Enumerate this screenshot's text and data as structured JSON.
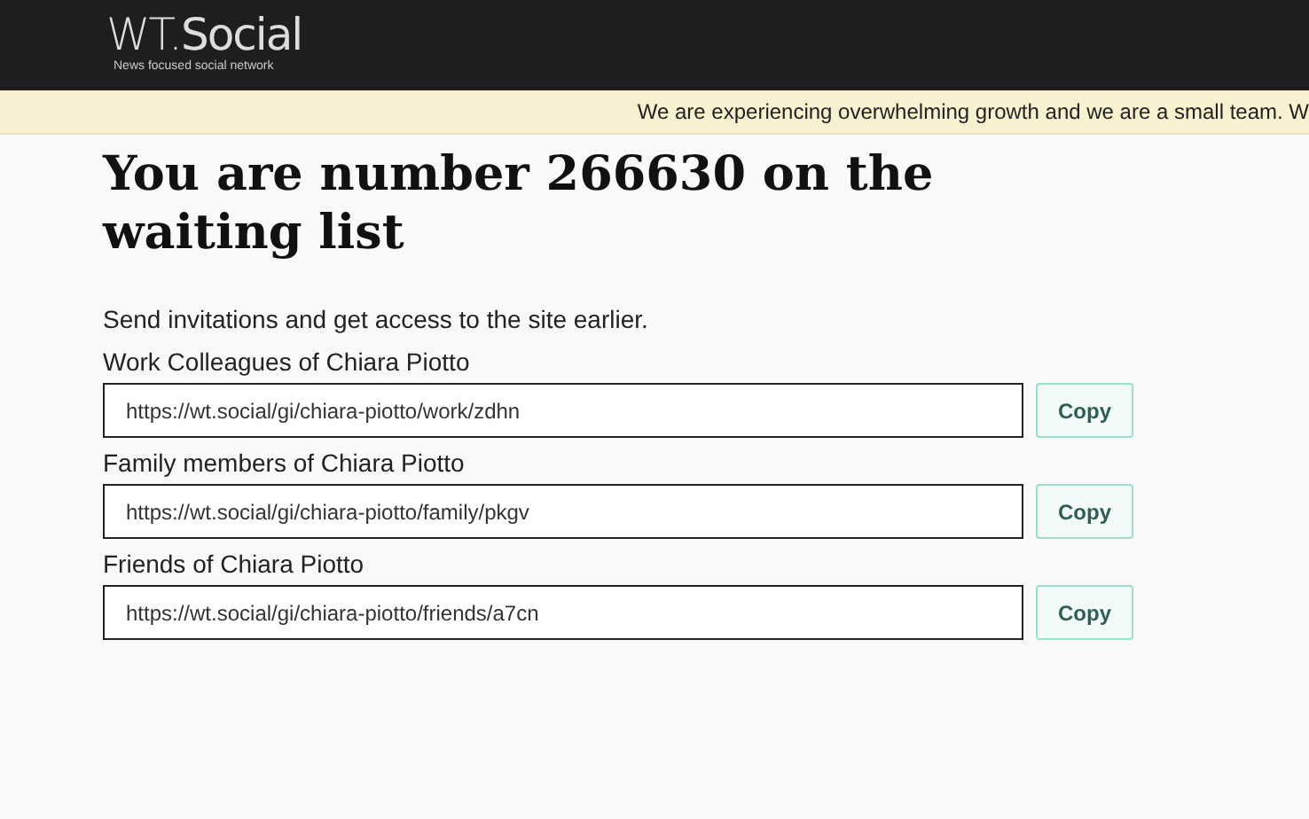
{
  "header": {
    "logo": "WT.**Social**",
    "tagline": "News focused social network"
  },
  "banner": "We are experiencing overwhelming growth and we are a small team. W",
  "heading": "You are number 266630 on the waiting list",
  "intro": "Send invitations and get access to the site earlier.",
  "invites": [
    {
      "label": "Work Colleagues of Chiara Piotto",
      "url": "https://wt.social/gi/chiara-piotto/work/zdhn",
      "button": "Copy"
    },
    {
      "label": "Family members of Chiara Piotto",
      "url": "https://wt.social/gi/chiara-piotto/family/pkgv",
      "button": "Copy"
    },
    {
      "label": "Friends of Chiara Piotto",
      "url": "https://wt.social/gi/chiara-piotto/friends/a7cn",
      "button": "Copy"
    }
  ]
}
